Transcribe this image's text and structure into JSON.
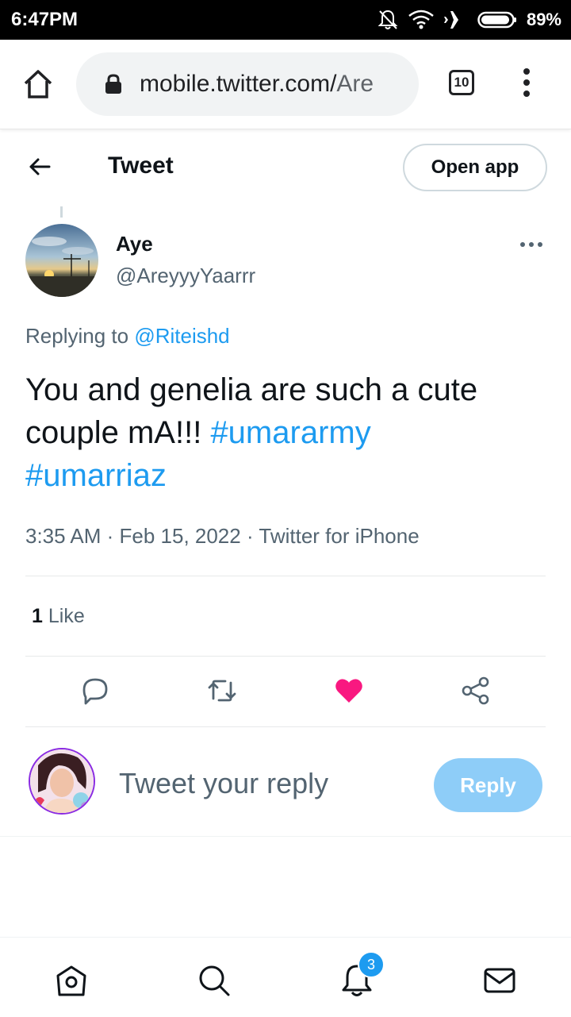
{
  "status_bar": {
    "time": "6:47PM",
    "battery": "89%"
  },
  "browser": {
    "url_host": "mobile.twitter.com/",
    "url_path": "Are",
    "tab_count": "10"
  },
  "header": {
    "title": "Tweet",
    "open_app_label": "Open app"
  },
  "tweet": {
    "author_name": "Aye",
    "author_handle": "@AreyyyYaarrr",
    "replying_prefix": "Replying to",
    "replying_to": "@Riteishd",
    "text_main": "You and genelia are such a cute couple mA!!! ",
    "hashtag_1": "#umararmy",
    "hashtag_2": "#umarriaz",
    "timestamp": "3:35 AM · Feb 15, 2022 · Twitter for iPhone",
    "like_count": "1",
    "like_label": "Like",
    "liked": true
  },
  "composer": {
    "placeholder": "Tweet your reply",
    "reply_label": "Reply"
  },
  "bottom_nav": {
    "notification_count": "3"
  },
  "colors": {
    "accent": "#1d9bf0",
    "like": "#f91880",
    "reply_button_disabled": "#8ecdf8",
    "secondary_text": "#536471"
  },
  "icons": [
    "home-icon",
    "lock-icon",
    "tabs-icon",
    "overflow-menu-icon",
    "back-arrow-icon",
    "more-icon",
    "reply-icon",
    "retweet-icon",
    "heart-icon",
    "share-icon",
    "search-icon",
    "bell-icon",
    "mail-icon"
  ]
}
